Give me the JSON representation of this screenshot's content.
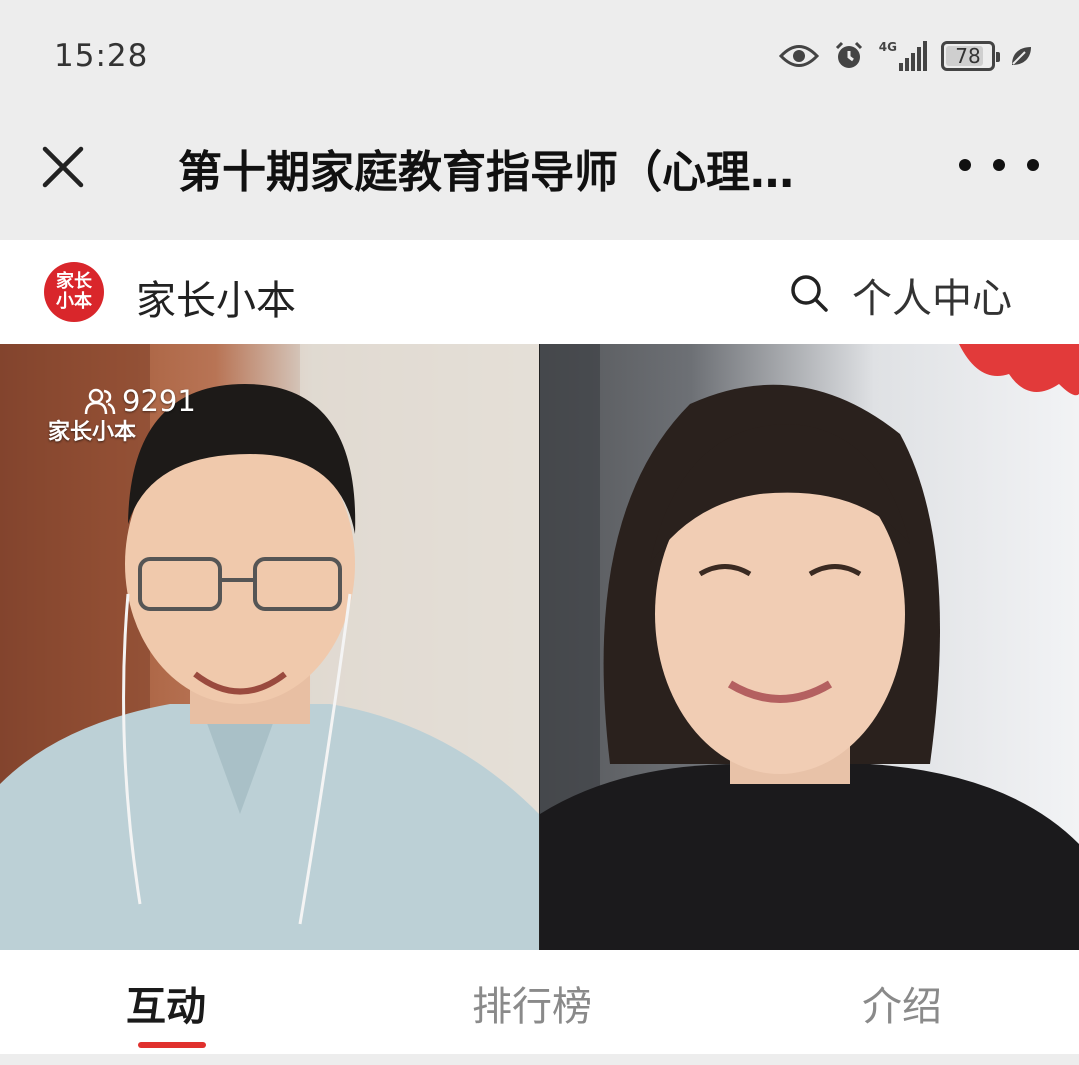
{
  "status_bar": {
    "time": "15:28",
    "network_label": "4G",
    "battery_level": "78",
    "icons": [
      "eye-icon",
      "alarm-icon",
      "signal-icon",
      "battery-icon",
      "leaf-icon"
    ]
  },
  "nav": {
    "title": "第十期家庭教育指导师（心理…",
    "close_icon": "close-icon",
    "more_icon": "more-icon"
  },
  "header": {
    "logo_line1": "家长",
    "logo_line2": "小本",
    "app_name": "家长小本",
    "search_icon": "search-icon",
    "personal_center": "个人中心"
  },
  "video": {
    "viewer_count": "9291",
    "watermark": "家长小本",
    "viewer_icon": "people-icon"
  },
  "tabs": [
    {
      "label": "互动",
      "active": true
    },
    {
      "label": "排行榜",
      "active": false
    },
    {
      "label": "介绍",
      "active": false
    }
  ],
  "colors": {
    "accent": "#e0312e",
    "logo_red": "#d9262b",
    "bar_bg": "#ededed"
  }
}
